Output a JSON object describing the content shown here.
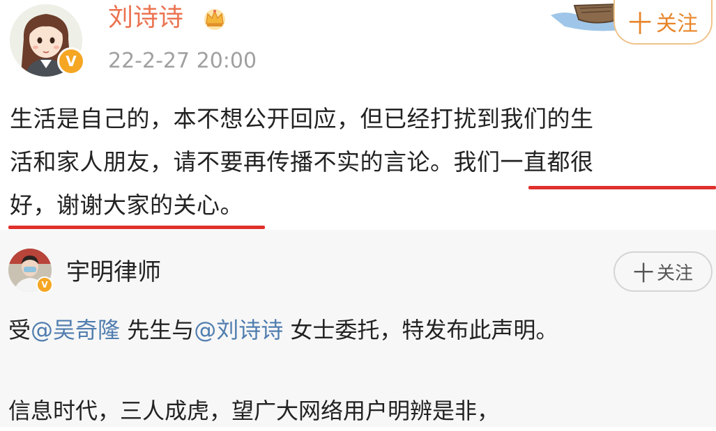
{
  "post1": {
    "username": "刘诗诗",
    "timestamp": "22-2-27 20:00",
    "follow_label": "关注",
    "follow_plus": "十",
    "verified_label": "V",
    "content": {
      "line1": "生活是自己的，本不想公开回应，但已经打扰到我们的生",
      "line2_a": "活和家人朋友，请不要再传播不实的言论。",
      "line2_b": "我们一直都很",
      "line3": "好，谢谢大家的关心。"
    },
    "icons": {
      "avatar": "cartoon-girl-avatar",
      "badge": "crown-icon",
      "decoration": "boat-icon",
      "verified": "verified-badge-icon"
    },
    "colors": {
      "username": "#eb7350",
      "follow": "#e8852a",
      "underline": "#e0302c"
    }
  },
  "post2": {
    "username": "宇明律师",
    "follow_label": "关注",
    "follow_plus": "十",
    "verified_label": "V",
    "content": {
      "line1_a": "受",
      "mention1": "@吴奇隆",
      "line1_b": " 先生与",
      "mention2": "@刘诗诗",
      "line1_c": " 女士委托，特发布此声明。",
      "line3": "信息时代，三人成虎，望广大网络用户明辨是非，"
    },
    "icons": {
      "avatar": "lawyer-photo-avatar",
      "verified": "verified-badge-icon"
    },
    "colors": {
      "mention": "#507daf"
    }
  }
}
